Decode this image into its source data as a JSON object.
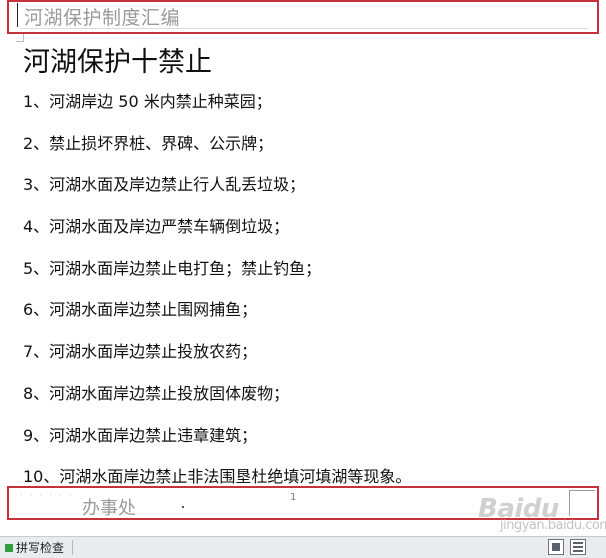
{
  "header": {
    "text": "河湖保护制度汇编"
  },
  "document": {
    "title": "河湖保护十禁止",
    "items": [
      "1、河湖岸边 50 米内禁止种菜园；",
      "2、禁止损坏界桩、界碑、公示牌；",
      "3、河湖水面及岸边禁止行人乱丢垃圾；",
      "4、河湖水面及岸边严禁车辆倒垃圾；",
      "5、河湖水面岸边禁止电打鱼；禁止钓鱼；",
      "6、河湖水面岸边禁止围网捕鱼；",
      "7、河湖水面岸边禁止投放农药；",
      "8、河湖水面岸边禁止投放固体废物；",
      "9、河湖水面岸边禁止违章建筑；",
      "10、河湖水面岸边禁止非法围垦杜绝填河填湖等现象。"
    ]
  },
  "footer": {
    "text": "办事处",
    "page_number": "1"
  },
  "statusbar": {
    "spell_check_label": "拼写检查"
  },
  "watermark": {
    "brand": "Baidu",
    "sub": "jingyan.baidu.com"
  },
  "colors": {
    "highlight_border": "#c8303a",
    "spell_check_indicator": "#2e9f3a"
  }
}
